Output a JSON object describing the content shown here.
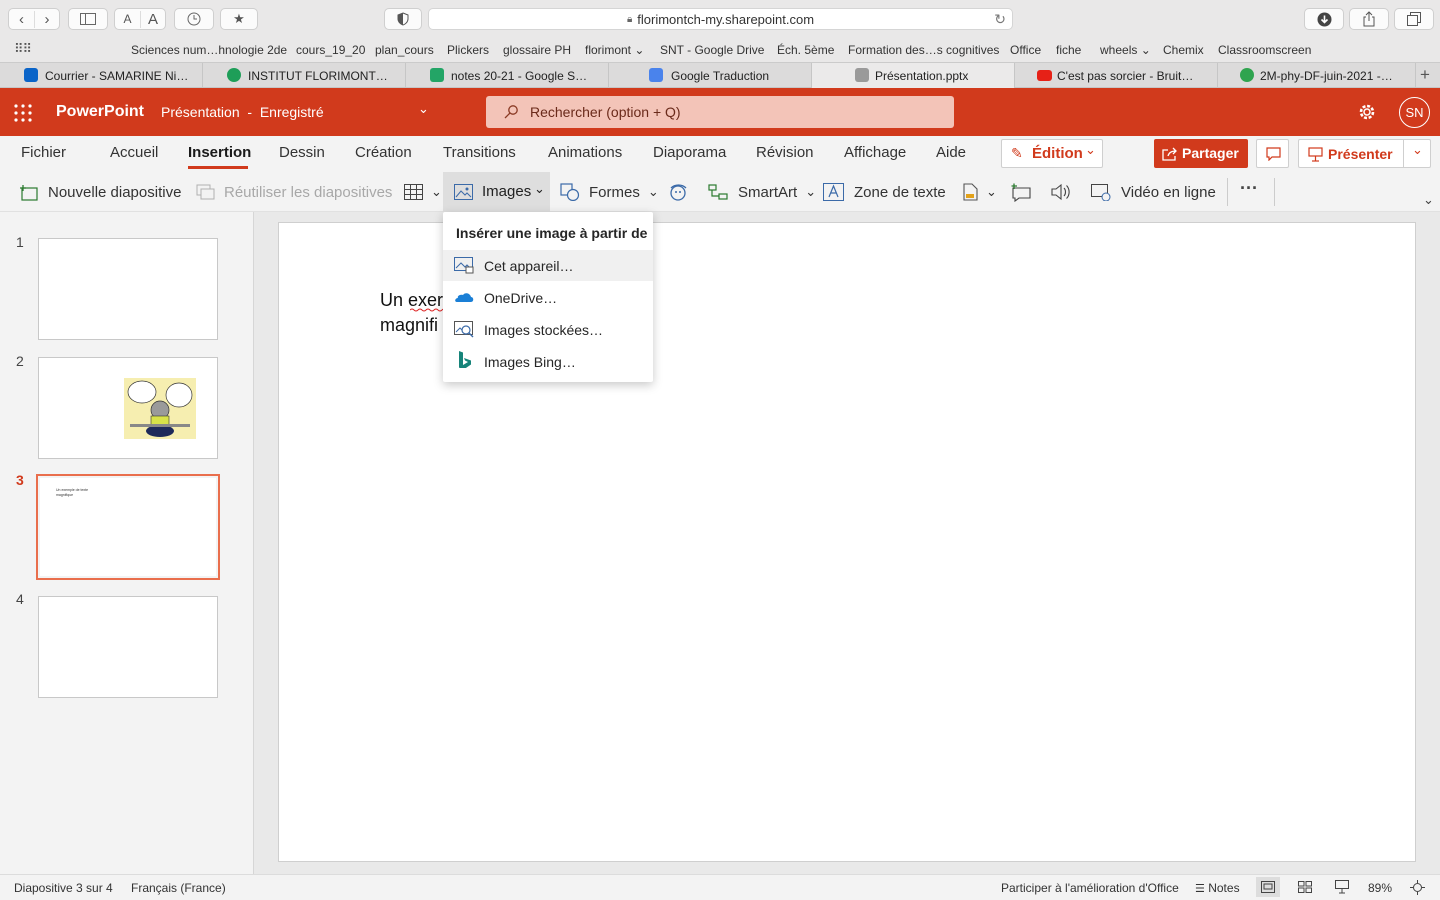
{
  "browser": {
    "url": "florimontch-my.sharepoint.com",
    "favorites": [
      "Sciences num…hnologie 2de",
      "cours_19_20",
      "plan_cours",
      "Plickers",
      "glossaire PH",
      "florimont",
      "SNT - Google Drive",
      "Éch. 5ème",
      "Formation des…s cognitives",
      "Office",
      "fiche",
      "wheels",
      "Chemix",
      "Classroomscreen"
    ],
    "tabs": [
      {
        "label": "Courrier - SAMARINE Ni…",
        "color": "#0a64c8"
      },
      {
        "label": "INSTITUT FLORIMONT…",
        "color": "#1e9e58"
      },
      {
        "label": "notes 20-21 - Google S…",
        "color": "#23a566"
      },
      {
        "label": "Google Traduction",
        "color": "#4a83ec"
      },
      {
        "label": "Présentation.pptx",
        "color": "#9a9a9a"
      },
      {
        "label": "C'est pas sorcier - Bruit…",
        "color": "#e62117"
      },
      {
        "label": "2M-phy-DF-juin-2021 -…",
        "color": "#2fa44f"
      }
    ]
  },
  "app": {
    "name": "PowerPoint",
    "doc_title": "Présentation  -  Enregistré",
    "search_placeholder": "Rechercher (option + Q)",
    "user_initials": "SN",
    "brand_color": "#d13a1c"
  },
  "menu": {
    "items": [
      "Fichier",
      "Accueil",
      "Insertion",
      "Dessin",
      "Création",
      "Transitions",
      "Animations",
      "Diaporama",
      "Révision",
      "Affichage",
      "Aide"
    ],
    "active": "Insertion",
    "edit_label": "Édition",
    "share_label": "Partager",
    "present_label": "Présenter"
  },
  "ribbon": {
    "new_slide": "Nouvelle diapositive",
    "reuse_slides": "Réutiliser les diapositives",
    "images": "Images",
    "shapes": "Formes",
    "smartart": "SmartArt",
    "textbox": "Zone de texte",
    "online_video": "Vidéo en ligne"
  },
  "dropdown": {
    "header": "Insérer une image à partir de",
    "items": [
      "Cet appareil…",
      "OneDrive…",
      "Images stockées…",
      "Images Bing…"
    ]
  },
  "slides": {
    "numbers": [
      "1",
      "2",
      "3",
      "4"
    ],
    "selected": 3,
    "thumb3_text": "Un exemple de texte magnifique"
  },
  "slide_content": {
    "line1": "Un exer",
    "line2": "magnifi"
  },
  "status": {
    "slide_info": "Diapositive 3 sur 4",
    "language": "Français (France)",
    "feedback": "Participer à l'amélioration d'Office",
    "notes": "Notes",
    "zoom": "89%"
  }
}
